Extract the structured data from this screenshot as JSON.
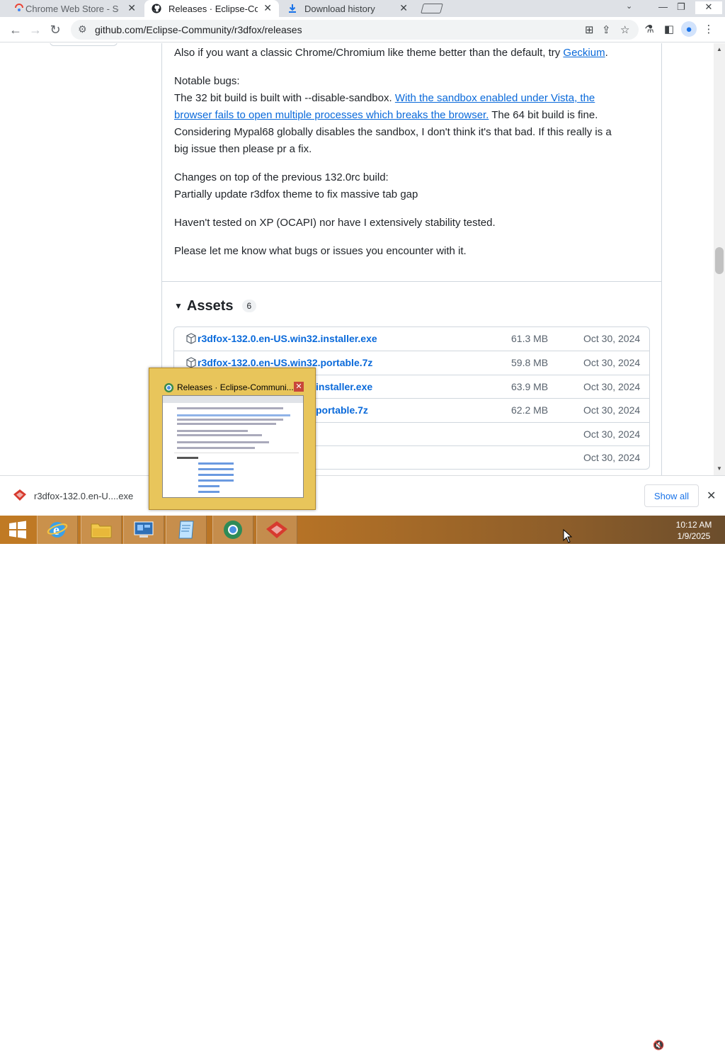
{
  "browser": {
    "tabs": [
      {
        "title": "Chrome Web Store - Se",
        "active": false,
        "icon": "chrome-web-store-icon"
      },
      {
        "title": "Releases · Eclipse-Comm",
        "active": true,
        "icon": "github-icon"
      },
      {
        "title": "Download history",
        "active": false,
        "icon": "download-icon"
      }
    ],
    "url": "github.com/Eclipse-Community/r3dfox/releases"
  },
  "release_notes": {
    "p1_text": "Also if you want a classic Chrome/Chromium like theme better than the default, try ",
    "p1_link": "Geckium",
    "p1_end": ".",
    "bugs_heading": "Notable bugs:",
    "bugs_text_a": "The 32 bit build is built with --disable-sandbox. ",
    "bugs_link_a": "With the sandbox enabled under Vista, the",
    "bugs_link_b": "browser fails to open multiple processes which breaks the browser.",
    "bugs_text_b": " The 64 bit build is fine.",
    "bugs_text_c": "Considering Mypal68 globally disables the sandbox, I don't think it's that bad. If this really is a",
    "bugs_text_d": "big issue then please pr a fix.",
    "changes_heading": "Changes on top of the previous 132.0rc build:",
    "changes_text": "Partially update r3dfox theme to fix massive tab gap",
    "tested": "Haven't tested on XP (OCAPI) nor have I extensively stability tested.",
    "feedback": "Please let me know what bugs or issues you encounter with it."
  },
  "assets": {
    "title": "Assets",
    "count": "6",
    "rows": [
      {
        "name": "r3dfox-132.0.en-US.win32.installer.exe",
        "size": "61.3 MB",
        "date": "Oct 30, 2024"
      },
      {
        "name": "r3dfox-132.0.en-US.win32.portable.7z",
        "size": "59.8 MB",
        "date": "Oct 30, 2024"
      },
      {
        "name": "installer.exe",
        "size": "63.9 MB",
        "date": "Oct 30, 2024"
      },
      {
        "name": "portable.7z",
        "size": "62.2 MB",
        "date": "Oct 30, 2024"
      },
      {
        "name": "",
        "size": "",
        "date": "Oct 30, 2024"
      },
      {
        "name": "",
        "size": "",
        "date": "Oct 30, 2024"
      }
    ]
  },
  "download_bar": {
    "filename": "r3dfox-132.0.en-U....exe",
    "show_all": "Show all"
  },
  "thumbnail": {
    "title": "Releases · Eclipse-Communi..."
  },
  "taskbar": {
    "time": "10:12 AM",
    "date": "1/9/2025"
  },
  "colors": {
    "link": "#0969da",
    "taskbar": "#b77326",
    "thumbnail_frame": "#e8c55b"
  }
}
